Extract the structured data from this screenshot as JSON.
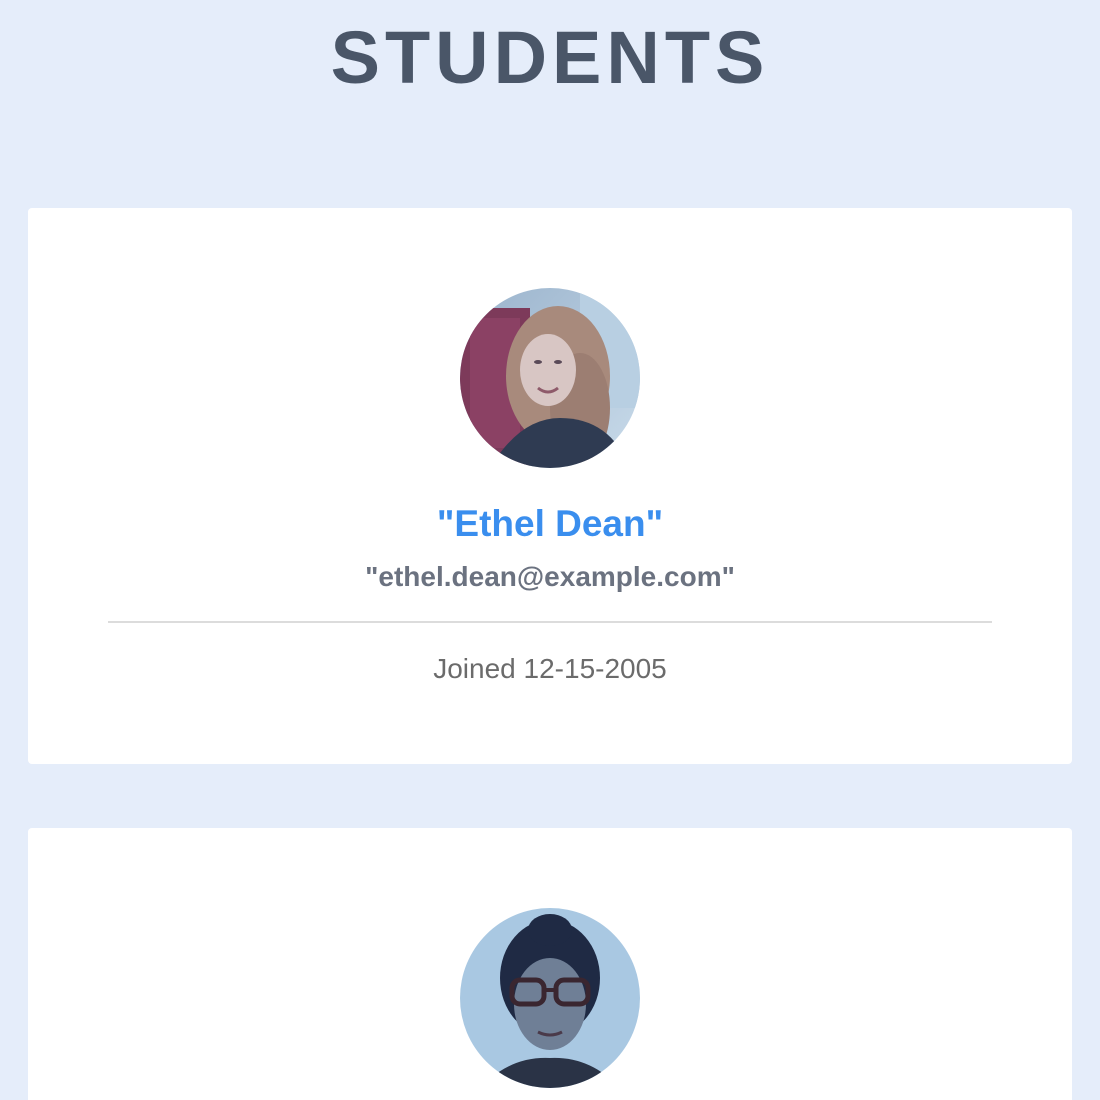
{
  "page": {
    "title": "STUDENTS"
  },
  "students": [
    {
      "name": "\"Ethel Dean\"",
      "email": "\"ethel.dean@example.com\"",
      "joined_label": "Joined",
      "joined_date": "12-15-2005",
      "avatar_icon": "student-photo"
    },
    {
      "avatar_icon": "student-photo"
    }
  ],
  "colors": {
    "background": "#e5edfa",
    "card": "#ffffff",
    "title": "#4a5668",
    "name_accent": "#3a8eee",
    "email": "#6b7280",
    "muted_text": "#6b6b6b",
    "divider": "#dcdcdc"
  }
}
